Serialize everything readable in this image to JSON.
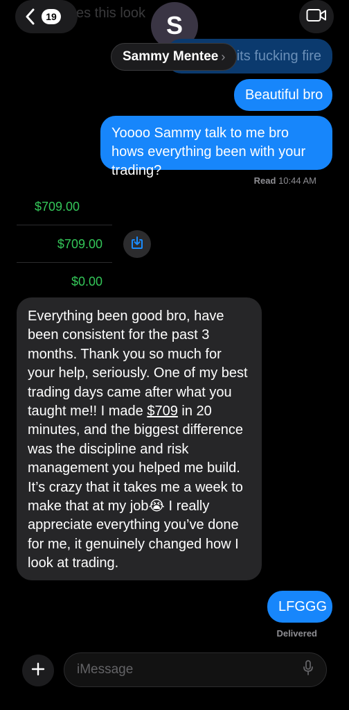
{
  "header": {
    "unread_count": "19",
    "faded_preview": "es this look",
    "avatar_initial": "S",
    "contact_name": "Sammy Mentee",
    "name_chevron": "›",
    "faded_bubble_text": "its fucking fire"
  },
  "messages": {
    "out1": "Beautiful bro",
    "out2": "Yoooo Sammy talk to me bro hows everything been with your trading?",
    "read_label": "Read",
    "read_time": "10:44 AM",
    "attachment_rows": [
      "$709.00",
      "$709.00",
      "$0.00"
    ],
    "in1_part1": "Everything been good bro, have been consistent for the past 3 months. Thank you so much for your help, seriously. One of my best trading days came after what you taught me!! I made ",
    "in1_link": "$709",
    "in1_part2": " in 20 minutes, and the biggest difference was the discipline and risk management you helped me build. It’s crazy that it takes me a week to make that at my job",
    "in1_emoji": "😭",
    "in1_part3": " I really appreciate everything you’ve done for me, it genuinely changed how I look at trading.",
    "out3": "LFGGG",
    "delivered_label": "Delivered"
  },
  "composer": {
    "placeholder": "iMessage"
  },
  "colors": {
    "outgoing": "#1786fb",
    "incoming": "#262628",
    "money": "#34c759"
  }
}
